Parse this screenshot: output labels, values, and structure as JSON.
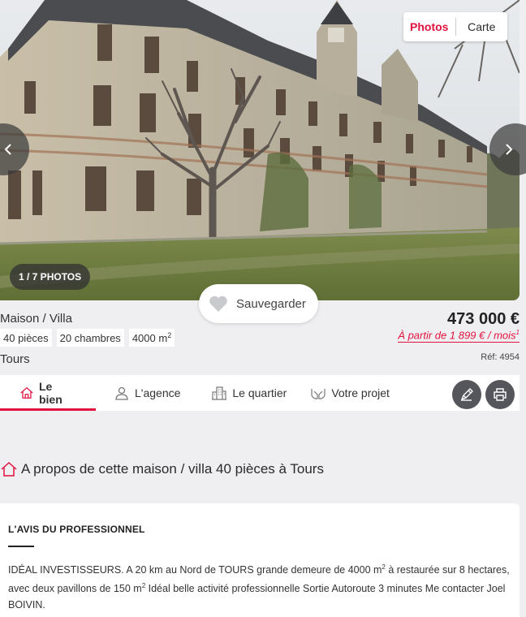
{
  "gallery": {
    "view_photos": "Photos",
    "view_map": "Carte",
    "counter": "1 / 7 PHOTOS",
    "save_label": "Sauvegarder"
  },
  "listing": {
    "property_type": "Maison / Villa",
    "rooms": "40 pièces",
    "bedrooms": "20 chambres",
    "area_value": "4000 m",
    "area_exp": "2",
    "price": "473 000 €",
    "monthly_text": "À partir de 1 899 € / mois",
    "monthly_note": "1",
    "city": "Tours",
    "reference": "Réf: 4954"
  },
  "tabs": [
    {
      "label": "Le bien",
      "icon": "home-icon",
      "active": true
    },
    {
      "label": "L'agence",
      "icon": "agent-icon",
      "active": false
    },
    {
      "label": "Le quartier",
      "icon": "building-icon",
      "active": false
    },
    {
      "label": "Votre projet",
      "icon": "hands-icon",
      "active": false
    }
  ],
  "about": {
    "title": "A propos de cette maison / villa 40 pièces à Tours"
  },
  "pro_review": {
    "heading": "L'AVIS DU PROFESSIONNEL",
    "text_part1": "IDÉAL INVESTISSEURS. A 20 km au Nord de TOURS grande demeure de 4000 m",
    "text_part2": " à restaurée sur 8 hectares, avec deux pavillons de 150 m",
    "text_part3": " Idéal belle activité professionnelle Sortie Autoroute 3 minutes Me contacter Joel BOIVIN."
  },
  "colors": {
    "accent": "#e2123f",
    "background": "#efeff2",
    "action_grey": "#54565c"
  }
}
